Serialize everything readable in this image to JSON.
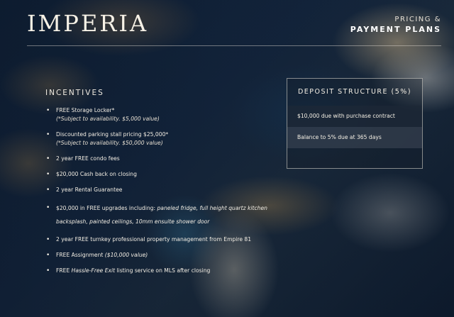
{
  "brand": {
    "logo": "IMPERIA"
  },
  "header": {
    "subtitle": "PRICING &",
    "title": "PAYMENT PLANS"
  },
  "incentives": {
    "title": "INCENTIVES",
    "items": [
      {
        "text": "FREE Storage Locker*",
        "note": "(*Subject to availability. $5,000 value)"
      },
      {
        "text": "Discounted parking stall pricing $25,000*",
        "note": "(*Subject to availability. $50,000 value)"
      },
      {
        "text": "2 year FREE condo fees"
      },
      {
        "text": "$20,000 Cash back on closing"
      },
      {
        "text": "2 year Rental Guarantee"
      },
      {
        "text": "$20,000 in FREE upgrades including: ",
        "italic": "paneled fridge, full height quartz kitchen backsplash, painted ceilings, 10mm ensuite shower door"
      },
      {
        "text": "2 year FREE turnkey professional property management from Empire 81"
      },
      {
        "text": "FREE Assignment ",
        "italic": "($10,000 value)"
      },
      {
        "text": "FREE ",
        "italic": "Hassle-Free Exit",
        "text_after": " listing service on MLS after closing"
      }
    ]
  },
  "deposit": {
    "title": "DEPOSIT STRUCTURE (5%)",
    "rows": [
      "$10,000 due with purchase contract",
      "Balance to 5% due at 365 days"
    ]
  }
}
